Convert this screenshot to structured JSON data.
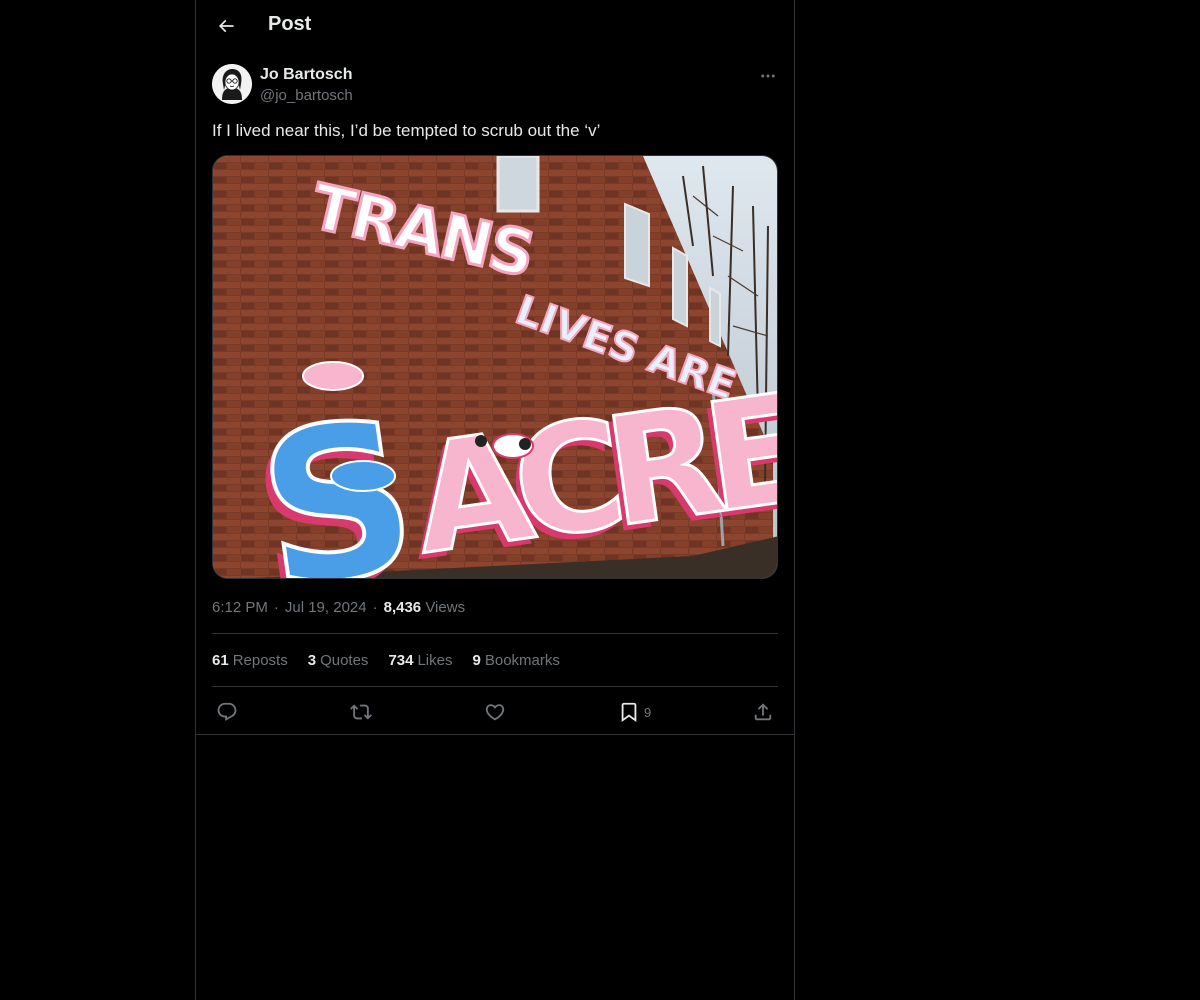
{
  "header": {
    "back_icon": "arrow-left-icon",
    "title": "Post"
  },
  "post": {
    "author": {
      "name": "Jo Bartosch",
      "handle": "@jo_bartosch",
      "avatar": "avatar-illustration"
    },
    "more_icon": "ellipsis-icon",
    "text": "If I lived near this, I’d be tempted to scrub out the ‘v’",
    "media": {
      "type": "photo",
      "mural_line1": "TRANS LIVES ARE",
      "mural_line2": "SACRED"
    },
    "meta": {
      "time": "6:12 PM",
      "date": "Jul 19, 2024",
      "views_count": "8,436",
      "views_label": "Views"
    },
    "stats": {
      "reposts_count": "61",
      "reposts_label": "Reposts",
      "quotes_count": "3",
      "quotes_label": "Quotes",
      "likes_count": "734",
      "likes_label": "Likes",
      "bookmarks_count": "9",
      "bookmarks_label": "Bookmarks"
    },
    "actions": {
      "reply_icon": "reply-icon",
      "repost_icon": "repost-icon",
      "like_icon": "heart-icon",
      "bookmark_icon": "bookmark-icon",
      "bookmark_count": "9",
      "share_icon": "share-icon"
    }
  },
  "colors": {
    "background": "#000000",
    "text_primary": "#e7e9ea",
    "text_secondary": "#71767b",
    "border": "#2f3336"
  }
}
